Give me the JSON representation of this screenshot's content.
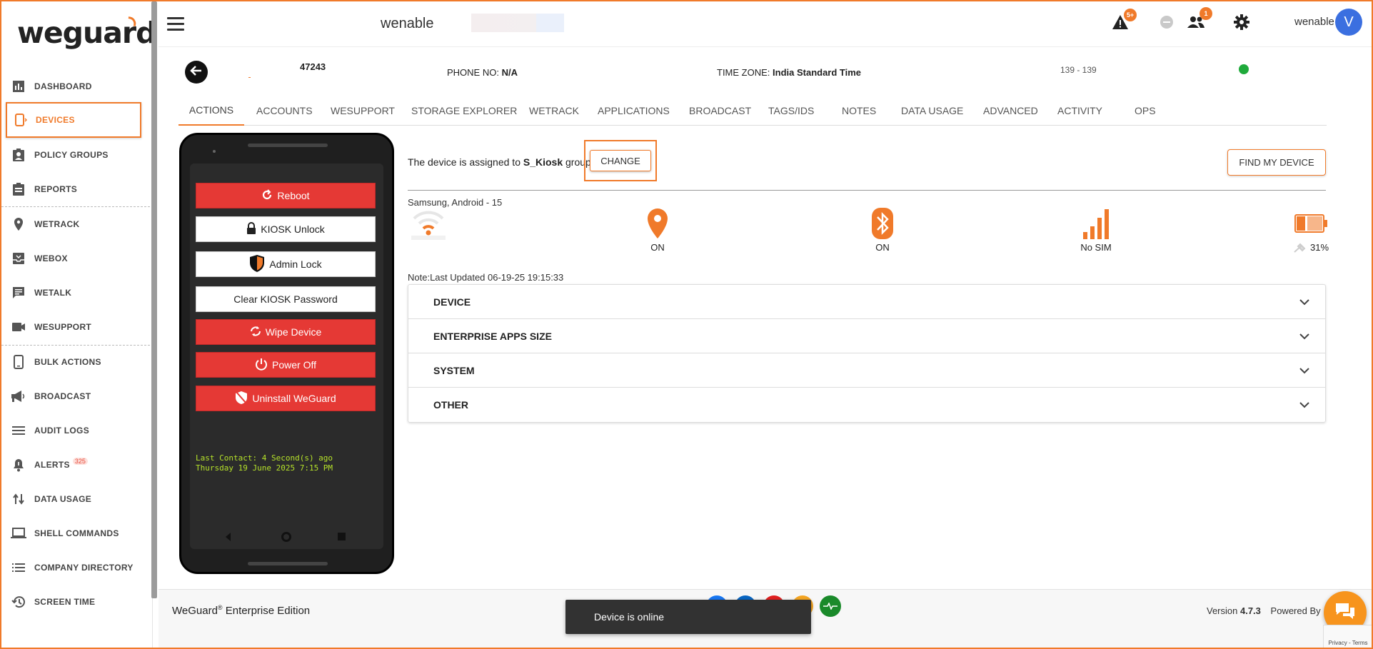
{
  "colors": {
    "accent": "#f07a2a",
    "danger": "#e53935",
    "online": "#1faa3b",
    "avatar": "#3b6fe0",
    "chat": "#f7941d"
  },
  "brand": {
    "logo_text": "weguard"
  },
  "sidebar": {
    "items": [
      {
        "label": "DASHBOARD",
        "icon": "bar-chart-icon"
      },
      {
        "label": "DEVICES",
        "icon": "device-icon"
      },
      {
        "label": "POLICY GROUPS",
        "icon": "clipboard-person-icon"
      },
      {
        "label": "REPORTS",
        "icon": "clipboard-icon"
      },
      {
        "label": "WETRACK",
        "icon": "location-pin-icon"
      },
      {
        "label": "WEBOX",
        "icon": "inbox-icon"
      },
      {
        "label": "WETALK",
        "icon": "chat-icon"
      },
      {
        "label": "WESUPPORT",
        "icon": "video-camera-icon"
      },
      {
        "label": "BULK ACTIONS",
        "icon": "smartphone-icon"
      },
      {
        "label": "BROADCAST",
        "icon": "megaphone-icon"
      },
      {
        "label": "AUDIT LOGS",
        "icon": "list-icon"
      },
      {
        "label": "ALERTS",
        "icon": "bell-alert-icon",
        "badge": "325"
      },
      {
        "label": "DATA USAGE",
        "icon": "up-down-arrows-icon"
      },
      {
        "label": "SHELL COMMANDS",
        "icon": "laptop-icon"
      },
      {
        "label": "COMPANY DIRECTORY",
        "icon": "directory-list-icon"
      },
      {
        "label": "SCREEN TIME",
        "icon": "history-icon"
      }
    ]
  },
  "header": {
    "org_name": "wenable",
    "alerts_badge": "5+",
    "users_badge": "1",
    "user_name": "wenable",
    "avatar_initial": "V"
  },
  "device": {
    "id": "47243",
    "phone_label": "PHONE NO:",
    "phone_value": "N/A",
    "timezone_label": "TIME ZONE:",
    "timezone_value": "India Standard Time",
    "range": "139 - 139"
  },
  "tabs": [
    "ACTIONS",
    "ACCOUNTS",
    "WESUPPORT",
    "STORAGE EXPLORER",
    "WETRACK",
    "APPLICATIONS",
    "BROADCAST",
    "TAGS/IDS",
    "NOTES",
    "DATA USAGE",
    "ADVANCED",
    "ACTIVITY",
    "OPS"
  ],
  "phone": {
    "buttons": [
      {
        "label": "Reboot",
        "icon": "refresh-icon"
      },
      {
        "label": "KIOSK Unlock",
        "icon": "lock-icon"
      },
      {
        "label": "Admin Lock",
        "icon": "shield-icon"
      },
      {
        "label": "Clear KIOSK Password",
        "icon": ""
      },
      {
        "label": "Wipe Device",
        "icon": "sync-icon"
      },
      {
        "label": "Power Off",
        "icon": "power-icon"
      },
      {
        "label": "Uninstall WeGuard",
        "icon": "shield-off-icon"
      }
    ],
    "contact_line1": "Last Contact: 4 Second(s) ago",
    "contact_line2": "Thursday 19 June 2025 7:15 PM"
  },
  "main": {
    "assigned_prefix": "The device is assigned to ",
    "assigned_group": "S_Kiosk",
    "assigned_suffix": " group",
    "change_label": "CHANGE",
    "find_label": "FIND MY DEVICE",
    "model": "Samsung, Android - 15",
    "stats": [
      {
        "icon": "wifi-icon",
        "label": ""
      },
      {
        "icon": "location-pin-icon",
        "label": "ON"
      },
      {
        "icon": "bluetooth-icon",
        "label": "ON"
      },
      {
        "icon": "signal-icon",
        "label": "No SIM"
      },
      {
        "icon": "battery-charging-icon",
        "label": "31%"
      }
    ],
    "note": "Note:Last Updated 06-19-25 19:15:33",
    "sections": [
      "DEVICE",
      "ENTERPRISE APPS SIZE",
      "SYSTEM",
      "OTHER"
    ]
  },
  "footer": {
    "edition_prefix": "WeGuard",
    "edition_reg": "®",
    "edition_suffix": " Enterprise Edition",
    "version_prefix": "Version ",
    "version_value": "4.7.3",
    "powered_by": "Powered By",
    "toast": "Device is online",
    "recaptcha": "Privacy - Terms"
  }
}
